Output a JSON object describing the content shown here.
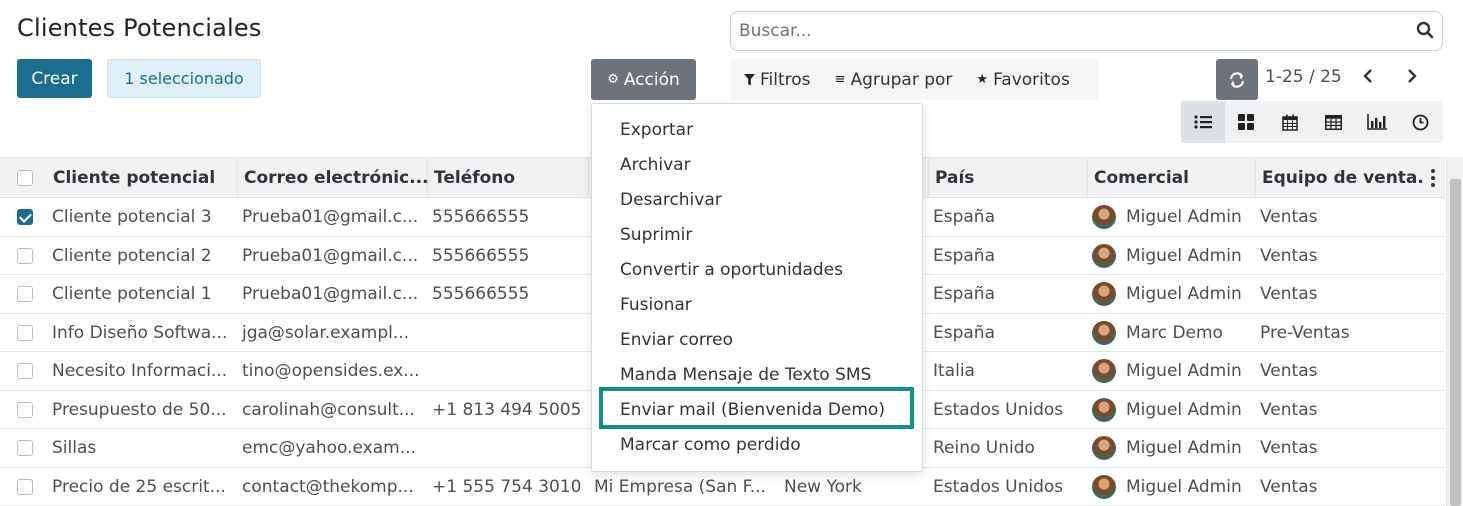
{
  "page": {
    "title": "Clientes Potenciales"
  },
  "buttons": {
    "create": "Crear",
    "selected": "1 seleccionado",
    "action": "Acción"
  },
  "search": {
    "placeholder": "Buscar..."
  },
  "filters": {
    "filters": "Filtros",
    "group_by": "Agrupar por",
    "favorites": "Favoritos"
  },
  "pager": {
    "range": "1-25 / 25"
  },
  "views": [
    "list-view",
    "kanban-view",
    "calendar-view",
    "pivot-view",
    "graph-view",
    "activity-view"
  ],
  "table": {
    "headers": [
      "Cliente potencial",
      "Correo electrónic...",
      "Teléfono",
      "",
      "",
      "País",
      "Comercial",
      "Equipo de venta..."
    ],
    "rows": [
      {
        "checked": true,
        "lead": "Cliente potencial 3",
        "email": "Prueba01@gmail.c...",
        "phone": "555666555",
        "company": "",
        "city": "",
        "country": "España",
        "salesperson": "Miguel Admin",
        "team": "Ventas"
      },
      {
        "checked": false,
        "lead": "Cliente potencial 2",
        "email": "Prueba01@gmail.c...",
        "phone": "555666555",
        "company": "",
        "city": "",
        "country": "España",
        "salesperson": "Miguel Admin",
        "team": "Ventas"
      },
      {
        "checked": false,
        "lead": "Cliente potencial 1",
        "email": "Prueba01@gmail.c...",
        "phone": "555666555",
        "company": "",
        "city": "",
        "country": "España",
        "salesperson": "Miguel Admin",
        "team": "Ventas"
      },
      {
        "checked": false,
        "lead": "Info Diseño Softwa...",
        "email": "jga@solar.exampl...",
        "phone": "",
        "company": "",
        "city": "",
        "country": "España",
        "salesperson": "Marc Demo",
        "team": "Pre-Ventas"
      },
      {
        "checked": false,
        "lead": "Necesito Informaci...",
        "email": "tino@opensides.ex...",
        "phone": "",
        "company": "",
        "city": "",
        "country": "Italia",
        "salesperson": "Miguel Admin",
        "team": "Ventas"
      },
      {
        "checked": false,
        "lead": "Presupuesto de 50...",
        "email": "carolinah@consult...",
        "phone": "+1 813 494 5005",
        "company": "",
        "city": "",
        "country": "Estados Unidos",
        "salesperson": "Miguel Admin",
        "team": "Ventas"
      },
      {
        "checked": false,
        "lead": "Sillas",
        "email": "emc@yahoo.exam...",
        "phone": "",
        "company": "",
        "city": "",
        "country": "Reino Unido",
        "salesperson": "Miguel Admin",
        "team": "Ventas"
      },
      {
        "checked": false,
        "lead": "Precio de 25 escrit...",
        "email": "contact@thekomp...",
        "phone": "+1 555 754 3010",
        "company": "Mi Empresa (San F...",
        "city": "New York",
        "country": "Estados Unidos",
        "salesperson": "Miguel Admin",
        "team": "Ventas"
      }
    ]
  },
  "action_menu": {
    "items": [
      "Exportar",
      "Archivar",
      "Desarchivar",
      "Suprimir",
      "Convertir a oportunidades",
      "Fusionar",
      "Enviar correo",
      "Manda Mensaje de Texto SMS",
      "Enviar mail (Bienvenida Demo)",
      "Marcar como perdido"
    ],
    "highlighted_index": 8,
    "highlight_color": "#0f9388"
  },
  "colors": {
    "primary": "#1b6e8f",
    "secondary": "#6c737b"
  }
}
